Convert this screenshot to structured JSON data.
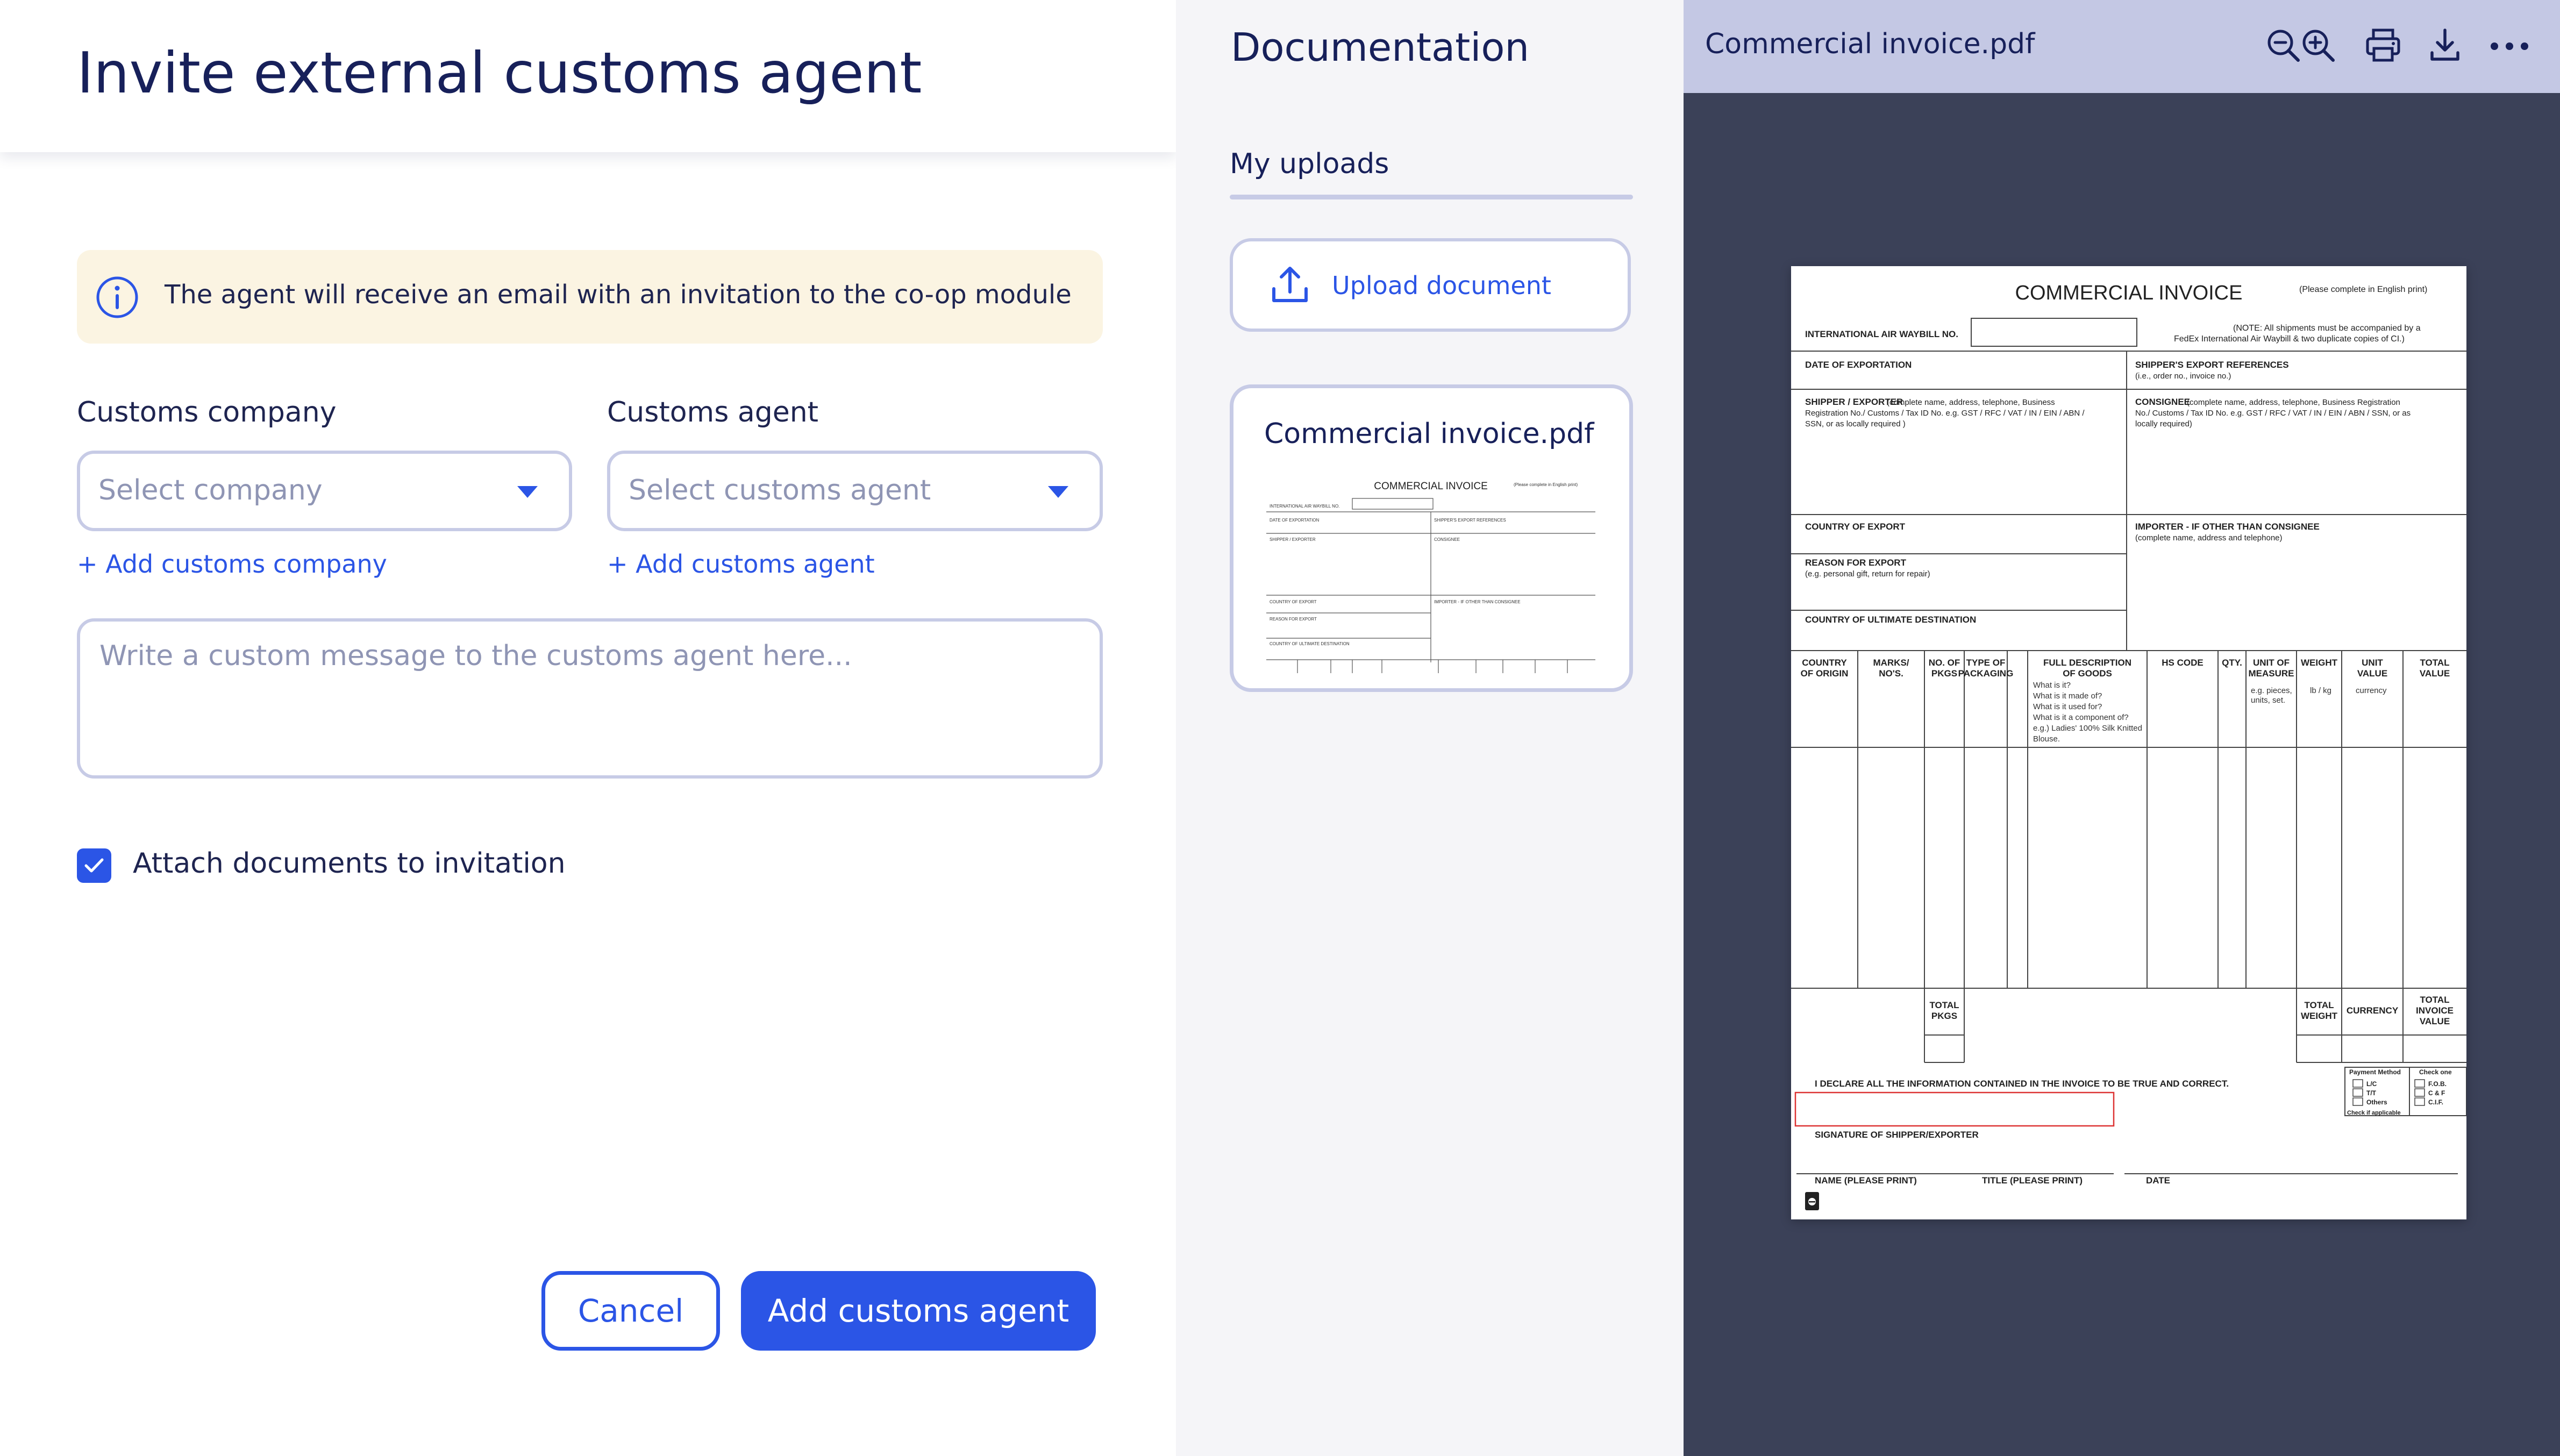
{
  "modal": {
    "title": "Invite external customs agent",
    "info_banner": "The agent will receive an email with an invitation to the co-op module",
    "company": {
      "label": "Customs company",
      "placeholder": "Select company",
      "add_link": "+ Add customs company"
    },
    "agent": {
      "label": "Customs agent",
      "placeholder": "Select customs agent",
      "add_link": "+ Add customs agent"
    },
    "message_placeholder": "Write a custom message to the customs agent here...",
    "attach_label": "Attach documents to invitation",
    "attach_checked": true,
    "cancel_label": "Cancel",
    "submit_label": "Add customs agent"
  },
  "documentation": {
    "title": "Documentation",
    "tab": "My uploads",
    "upload_label": "Upload document",
    "file_name": "Commercial invoice.pdf"
  },
  "viewer": {
    "file_name": "Commercial invoice.pdf",
    "tools": [
      "zoom-out-icon",
      "zoom-in-icon",
      "print-icon",
      "download-icon",
      "more-icon"
    ]
  },
  "invoice": {
    "title": "COMMERCIAL INVOICE",
    "english_note": "(Please complete in English print)",
    "waybill_label": "INTERNATIONAL AIR WAYBILL NO.",
    "waybill_note_1": "(NOTE: All shipments must be accompanied by a",
    "waybill_note_2": "FedEx International Air Waybill & two duplicate copies of CI.)",
    "date_export": "DATE OF EXPORTATION",
    "shipper_refs": "SHIPPER'S EXPORT REFERENCES",
    "shipper_refs_sub": "(i.e., order no., invoice no.)",
    "shipper_label": "SHIPPER / EXPORTER",
    "shipper_desc_1": "(complete name, address, telephone, Business",
    "shipper_desc_2": "Registration No./ Customs / Tax ID No. e.g. GST / RFC / VAT / IN / EIN / ABN /",
    "shipper_desc_3": "SSN, or as locally required )",
    "consignee_label": "CONSIGNEE",
    "consignee_desc_1": "(complete name, address, telephone, Business Registration",
    "consignee_desc_2": "No./ Customs / Tax ID No. e.g. GST / RFC / VAT / IN / EIN / ABN / SSN, or as",
    "consignee_desc_3": "locally required)",
    "country_export": "COUNTRY OF EXPORT",
    "importer_label": "IMPORTER - IF OTHER THAN CONSIGNEE",
    "importer_sub": "(complete name, address and telephone)",
    "reason_label": "REASON FOR EXPORT",
    "reason_sub": "(e.g. personal gift, return for repair)",
    "ultimate_dest": "COUNTRY OF ULTIMATE DESTINATION",
    "col_country": [
      "COUNTRY",
      "OF ORIGIN"
    ],
    "col_marks": [
      "MARKS/",
      "NO'S."
    ],
    "col_pkgs": [
      "NO. OF",
      "PKGS"
    ],
    "col_type": [
      "TYPE OF",
      "PACKAGING"
    ],
    "col_desc": [
      "FULL DESCRIPTION",
      "OF GOODS"
    ],
    "col_desc_hints": [
      "What is it?",
      "What is it made of?",
      "What is it used for?",
      "What is it a component of?",
      "e.g.) Ladies' 100% Silk Knitted",
      "Blouse."
    ],
    "col_hs": "HS CODE",
    "col_qty": "QTY.",
    "col_unit": [
      "UNIT OF",
      "MEASURE"
    ],
    "col_unit_sub": [
      "e.g. pieces,",
      "units, set."
    ],
    "col_weight": "WEIGHT",
    "col_weight_sub": "lb / kg",
    "col_unit_value": [
      "UNIT",
      "VALUE"
    ],
    "col_unit_value_sub": "currency",
    "col_total_value": [
      "TOTAL",
      "VALUE"
    ],
    "total_pkgs": [
      "TOTAL",
      "PKGS"
    ],
    "total_weight": [
      "TOTAL",
      "WEIGHT"
    ],
    "currency": "CURRENCY",
    "total_invoice": [
      "TOTAL",
      "INVOICE",
      "VALUE"
    ],
    "declare": "I DECLARE ALL THE INFORMATION CONTAINED IN THE INVOICE TO BE TRUE AND CORRECT.",
    "signature": "SIGNATURE OF SHIPPER/EXPORTER",
    "name_print": "NAME (PLEASE PRINT)",
    "title_print": "TITLE (PLEASE PRINT)",
    "date": "DATE",
    "payment_method": "Payment Method",
    "payment_options": [
      "L/C",
      "T/T",
      "Others"
    ],
    "check_applicable": "Check if applicable",
    "check_one": "Check one",
    "terms": [
      "F.O.B.",
      "C & F",
      "C.I.F."
    ]
  },
  "colors": {
    "accent": "#2b55e6",
    "title": "#17205a",
    "banner_bg": "#fbf4e2",
    "border": "#c7cbe6",
    "viewer_bg": "#3b4158",
    "viewer_bar": "#c4c8e4"
  }
}
